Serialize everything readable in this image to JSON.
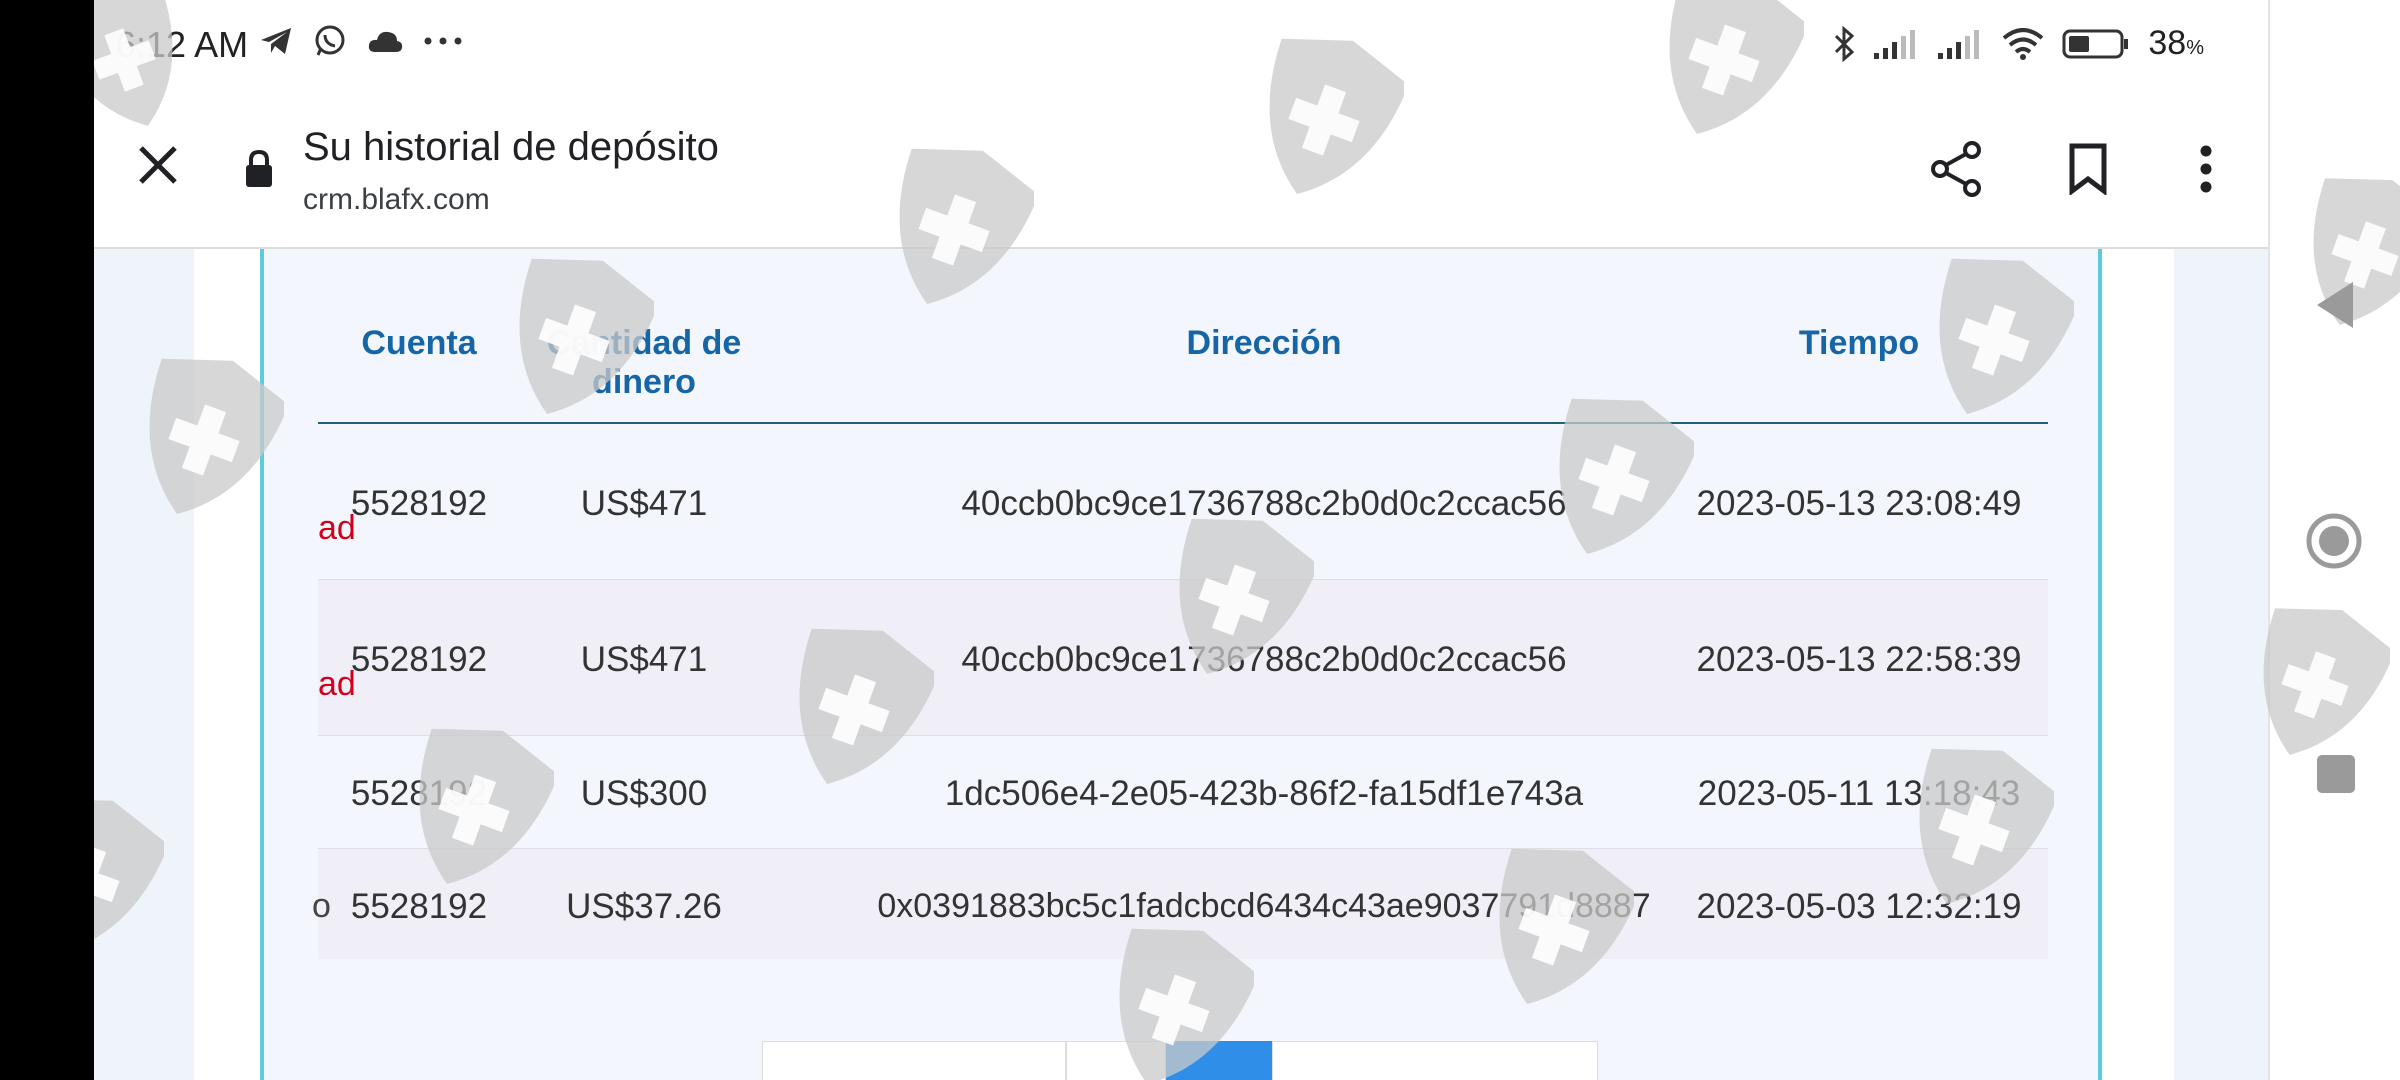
{
  "status_bar": {
    "time": "6:12 AM",
    "battery": "38",
    "battery_unit": "%",
    "icons": [
      "telegram-icon",
      "whatsapp-icon",
      "cloud-icon",
      "more-notifications-icon",
      "bluetooth-icon",
      "signal-icon",
      "signal-icon",
      "wifi-icon",
      "battery-icon"
    ]
  },
  "browser": {
    "title": "Su historial de depósito",
    "url": "crm.blafx.com",
    "icons": [
      "close-icon",
      "lock-icon",
      "share-icon",
      "bookmark-icon",
      "more-vert-icon"
    ]
  },
  "table": {
    "headers": {
      "account": "Cuenta",
      "amount": "Cantidad de dinero",
      "address": "Dirección",
      "time": "Tiempo"
    },
    "rows": [
      {
        "status": "ad",
        "account": "5528192",
        "amount": "US$471",
        "address": "40ccb0bc9ce1736788c2b0d0c2ccac56",
        "time": "2023-05-13 23:08:49"
      },
      {
        "status": "ad",
        "account": "5528192",
        "amount": "US$471",
        "address": "40ccb0bc9ce1736788c2b0d0c2ccac56",
        "time": "2023-05-13 22:58:39"
      },
      {
        "status": "",
        "account": "5528192",
        "amount": "US$300",
        "address": "1dc506e4-2e05-423b-86f2-fa15df1e743a",
        "time": "2023-05-11 13:18:43"
      },
      {
        "status": "o",
        "account": "5528192",
        "amount": "US$37.26",
        "address": "0x0391883bc5c1fadcbcd6434c43ae9037791d8887",
        "time": "2023-05-03 12:32:19"
      }
    ]
  },
  "colors": {
    "header_text": "#1565a7",
    "status_red": "#d0021b",
    "accent_border": "#5bcbe0",
    "page_active": "#2f8fe8"
  }
}
